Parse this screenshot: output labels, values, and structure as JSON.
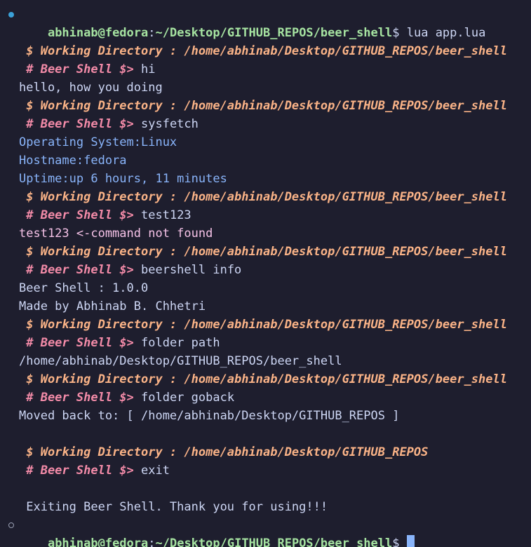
{
  "shell": {
    "user_host": "abhinab@fedora",
    "colon": ":",
    "cwd": "~/Desktop/GITHUB_REPOS/beer_shell",
    "dollar": "$",
    "first_command": " lua app.lua"
  },
  "beer": {
    "wd_full": " $ Working Directory : /home/abhinab/Desktop/GITHUB_REPOS/beer_shell",
    "wd_parent": " $ Working Directory : /home/abhinab/Desktop/GITHUB_REPOS",
    "prompt": " # Beer Shell $> ",
    "commands": {
      "hi": "hi",
      "sysfetch": "sysfetch",
      "test": "test123",
      "info": "beershell info",
      "path": "folder path",
      "goback": "folder goback",
      "exit": "exit"
    },
    "outputs": {
      "hi": "hello, how you doing",
      "os": "Operating System:Linux",
      "hostname": "Hostname:fedora",
      "uptime": "Uptime:up 6 hours, 11 minutes",
      "not_found": "test123 <-command not found",
      "version": "Beer Shell : 1.0.0",
      "author": "Made by Abhinab B. Chhetri",
      "path": "/home/abhinab/Desktop/GITHUB_REPOS/beer_shell",
      "moved": "Moved back to: [ /home/abhinab/Desktop/GITHUB_REPOS ]",
      "exiting": " Exiting Beer Shell. Thank you for using!!!"
    }
  },
  "colors": {
    "background": "#1e1e2e",
    "user_host": "#a6e3a1",
    "working_dir": "#fab387",
    "beer_prompt": "#f38ba8",
    "sysinfo": "#89b4fa",
    "error": "#f5c2e7",
    "cursor": "#89b4fa"
  },
  "icons": {
    "command_marker_done": "filled-circle-icon",
    "command_marker_active": "hollow-circle-icon"
  }
}
